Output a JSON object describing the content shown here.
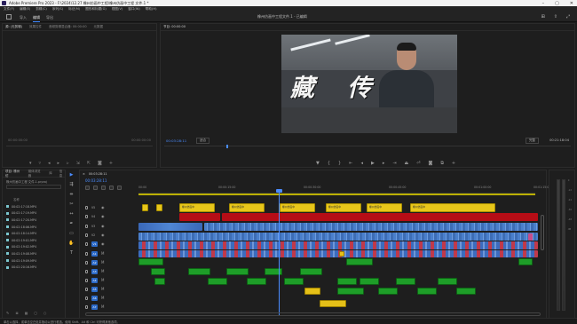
{
  "window": {
    "title": "Adobe Premiere Pro 2023 - F:\\2024\\12.27 橡州仿画中工程\\橡州仿画中工程 文件.1 *"
  },
  "menu": [
    "文件(F)",
    "编辑(E)",
    "剪辑(C)",
    "序列(S)",
    "标记(M)",
    "图形和标题(G)",
    "视图(V)",
    "窗口(W)",
    "帮助(H)"
  ],
  "workspace": {
    "tabs": [
      "导入",
      "编辑",
      "导出"
    ],
    "active_tab": "编辑",
    "project_name": "橡州仿画中工程文件.1 - 已编辑"
  },
  "source_panel": {
    "tabs": [
      "源: (无剪辑)",
      "效果控件",
      "音频剪辑混合器: 00:00:00",
      "元数据"
    ],
    "tc_left": "00:00:00:00",
    "tc_right": "00:00:00:00"
  },
  "program_panel": {
    "tab": "节目: 00:00:00",
    "overlay_text": "藏 传",
    "timecode": "00:03:28:11",
    "fit": "适合",
    "quality": "完整",
    "duration": "00:21:18:04"
  },
  "project_panel": {
    "tabs": [
      "项目: 橡州仿",
      "媒体浏览器",
      "库",
      "信息"
    ],
    "path": "橡州仿画中工程 文件.1.prproj",
    "column_header": "名称",
    "items": [
      "00:02:17:18.MP4",
      "00:02:17:19.MP4",
      "00:02:17:20.MP4",
      "00:02:18:06.MP4",
      "00:02:18:14.MP4",
      "00:02:19:01.MP4",
      "00:02:19:02.MP4",
      "00:02:19:08.MP4",
      "00:02:19:09.MP4",
      "00:02:20:16.MP4"
    ]
  },
  "timeline": {
    "sequence_tab": "00:03:28:11",
    "timecode": "00:03:28:11",
    "ruler_ticks": [
      "00:00",
      "00:00:15:00",
      "00:00:30:00",
      "00:00:45:00",
      "00:01:00:00",
      "00:01:15:00"
    ],
    "tracks": [
      {
        "id": "V5",
        "kind": "video"
      },
      {
        "id": "V4",
        "kind": "video"
      },
      {
        "id": "V3",
        "kind": "video"
      },
      {
        "id": "V2",
        "kind": "video"
      },
      {
        "id": "V1",
        "kind": "video"
      },
      {
        "id": "A1",
        "kind": "audio"
      },
      {
        "id": "A2",
        "kind": "audio"
      },
      {
        "id": "A3",
        "kind": "audio"
      },
      {
        "id": "A4",
        "kind": "audio"
      },
      {
        "id": "A5",
        "kind": "audio"
      },
      {
        "id": "A6",
        "kind": "audio"
      },
      {
        "id": "A7",
        "kind": "audio"
      },
      {
        "id": "A8",
        "kind": "audio"
      }
    ],
    "title_clip_label": "橡州仿画中"
  },
  "meter": {
    "scale": [
      "0",
      "-12",
      "-24",
      "-36",
      "-48",
      "dB"
    ]
  },
  "status": "单击以选择，或单击空白处并拖动以进行框选。使用 Shift、Alt 和 Ctrl 可获得其他选项。",
  "colors": {
    "accent": "#4a8cff",
    "title_clips": "#e8c61a",
    "adjustment_red": "#b60d16",
    "video_clips": "#4f86d4",
    "audio_clips": "#1e9d28"
  }
}
